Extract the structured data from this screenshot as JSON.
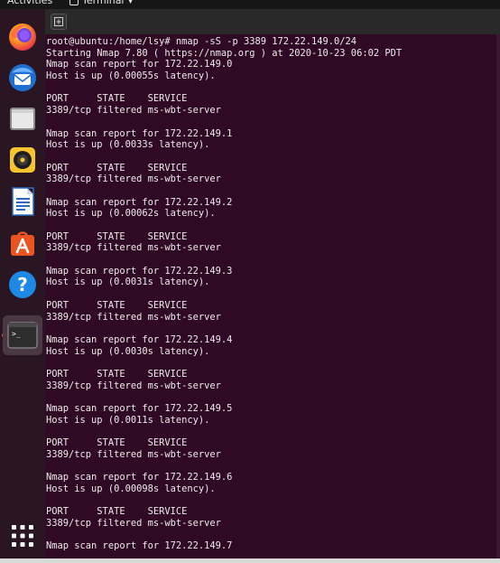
{
  "topbar": {
    "activities": "Activities",
    "app_name": "Terminal"
  },
  "dock": {
    "items": [
      {
        "name": "firefox-icon",
        "label": "Firefox"
      },
      {
        "name": "thunderbird-icon",
        "label": "Thunderbird Mail"
      },
      {
        "name": "files-icon",
        "label": "Files"
      },
      {
        "name": "rhythmbox-icon",
        "label": "Rhythmbox"
      },
      {
        "name": "libreoffice-writer-icon",
        "label": "LibreOffice Writer"
      },
      {
        "name": "ubuntu-software-icon",
        "label": "Ubuntu Software"
      },
      {
        "name": "help-icon",
        "label": "Help"
      },
      {
        "name": "terminal-icon",
        "label": "Terminal"
      },
      {
        "name": "show-applications-icon",
        "label": "Show Applications"
      }
    ]
  },
  "terminal": {
    "lines": [
      "root@ubuntu:/home/lsy# nmap -sS -p 3389 172.22.149.0/24",
      "Starting Nmap 7.80 ( https://nmap.org ) at 2020-10-23 06:02 PDT",
      "Nmap scan report for 172.22.149.0",
      "Host is up (0.00055s latency).",
      "",
      "PORT     STATE    SERVICE",
      "3389/tcp filtered ms-wbt-server",
      "",
      "Nmap scan report for 172.22.149.1",
      "Host is up (0.0033s latency).",
      "",
      "PORT     STATE    SERVICE",
      "3389/tcp filtered ms-wbt-server",
      "",
      "Nmap scan report for 172.22.149.2",
      "Host is up (0.00062s latency).",
      "",
      "PORT     STATE    SERVICE",
      "3389/tcp filtered ms-wbt-server",
      "",
      "Nmap scan report for 172.22.149.3",
      "Host is up (0.0031s latency).",
      "",
      "PORT     STATE    SERVICE",
      "3389/tcp filtered ms-wbt-server",
      "",
      "Nmap scan report for 172.22.149.4",
      "Host is up (0.0030s latency).",
      "",
      "PORT     STATE    SERVICE",
      "3389/tcp filtered ms-wbt-server",
      "",
      "Nmap scan report for 172.22.149.5",
      "Host is up (0.0011s latency).",
      "",
      "PORT     STATE    SERVICE",
      "3389/tcp filtered ms-wbt-server",
      "",
      "Nmap scan report for 172.22.149.6",
      "Host is up (0.00098s latency).",
      "",
      "PORT     STATE    SERVICE",
      "3389/tcp filtered ms-wbt-server",
      "",
      "Nmap scan report for 172.22.149.7"
    ]
  },
  "colors": {
    "terminal_bg": "#300a24",
    "terminal_fg": "#ececec",
    "accent": "#e95420"
  }
}
